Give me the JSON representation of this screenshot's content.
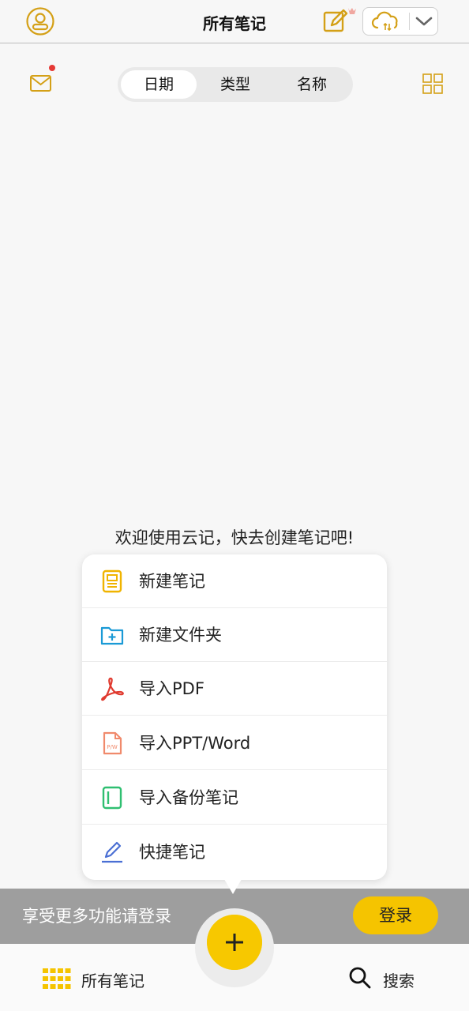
{
  "header": {
    "title": "所有笔记"
  },
  "tabs": [
    {
      "label": "日期",
      "active": true
    },
    {
      "label": "类型",
      "active": false
    },
    {
      "label": "名称",
      "active": false
    }
  ],
  "welcome": "欢迎使用云记，快去创建笔记吧!",
  "menu": {
    "items": [
      {
        "label": "新建笔记",
        "icon": "note-icon"
      },
      {
        "label": "新建文件夹",
        "icon": "folder-add-icon"
      },
      {
        "label": "导入PDF",
        "icon": "pdf-icon"
      },
      {
        "label": "导入PPT/Word",
        "icon": "ppt-word-icon"
      },
      {
        "label": "导入备份笔记",
        "icon": "backup-icon"
      },
      {
        "label": "快捷笔记",
        "icon": "pen-icon"
      }
    ]
  },
  "login_bar": {
    "text": "享受更多功能请登录",
    "button": "登录"
  },
  "bottom_nav": {
    "notes_label": "所有笔记",
    "search_label": "搜索"
  },
  "colors": {
    "accent": "#f5c400",
    "notification_dot": "#e53935",
    "banner": "#9e9e9e"
  }
}
